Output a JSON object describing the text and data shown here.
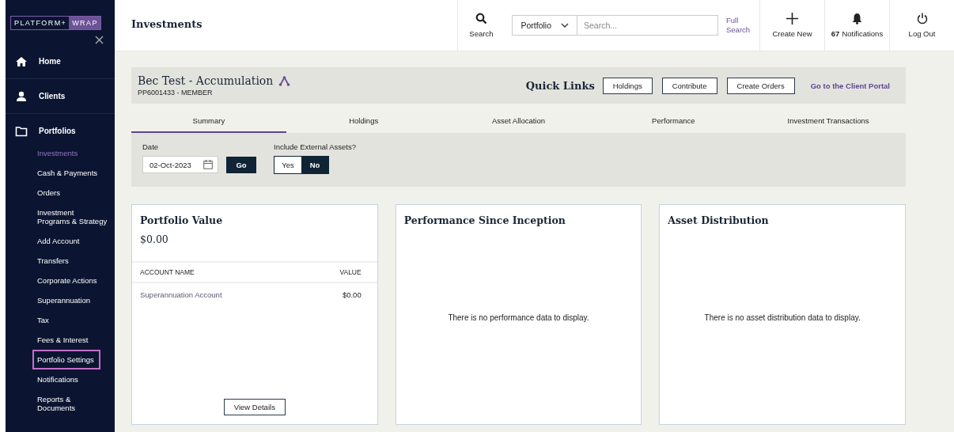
{
  "brand": {
    "part_1": "PLATFORM+",
    "part_2": "WRAP"
  },
  "sidebar": {
    "items": [
      {
        "label": "Home",
        "selected": false
      },
      {
        "label": "Clients",
        "selected": false
      },
      {
        "label": "Portfolios",
        "selected": false,
        "children": [
          {
            "label": "Investments",
            "selected": true,
            "highlighted": false
          },
          {
            "label": "Cash & Payments",
            "selected": false,
            "highlighted": false
          },
          {
            "label": "Orders",
            "selected": false,
            "highlighted": false
          },
          {
            "label": "Investment Programs & Strategy",
            "selected": false,
            "highlighted": false
          },
          {
            "label": "Add Account",
            "selected": false,
            "highlighted": false
          },
          {
            "label": "Transfers",
            "selected": false,
            "highlighted": false
          },
          {
            "label": "Corporate Actions",
            "selected": false,
            "highlighted": false
          },
          {
            "label": "Superannuation",
            "selected": false,
            "highlighted": false
          },
          {
            "label": "Tax",
            "selected": false,
            "highlighted": false
          },
          {
            "label": "Fees & Interest",
            "selected": false,
            "highlighted": false
          },
          {
            "label": "Portfolio Settings",
            "selected": false,
            "highlighted": true
          },
          {
            "label": "Notifications",
            "selected": false,
            "highlighted": false
          },
          {
            "label": "Reports & Documents",
            "selected": false,
            "highlighted": false
          }
        ]
      }
    ]
  },
  "header": {
    "title": "Investments",
    "search_label": "Search",
    "scope": "Portfolio",
    "placeholder": "Search...",
    "full_search": "Full Search",
    "actions": [
      {
        "kind": "create",
        "label": "Create New"
      },
      {
        "kind": "notifications",
        "count": "67",
        "label": "Notifications"
      },
      {
        "kind": "logout",
        "label": "Log Out"
      }
    ]
  },
  "client": {
    "name": "Bec Test - Accumulation",
    "code": "PP6001433 - MEMBER",
    "quick_links_title": "Quick Links",
    "quick_links": [
      "Holdings",
      "Contribute",
      "Create Orders"
    ],
    "portal_link": "Go to the Client Portal"
  },
  "tabs": [
    {
      "label": "Summary",
      "selected": true
    },
    {
      "label": "Holdings",
      "selected": false
    },
    {
      "label": "Asset Allocation",
      "selected": false
    },
    {
      "label": "Performance",
      "selected": false
    },
    {
      "label": "Investment Transactions",
      "selected": false
    }
  ],
  "filters": {
    "date_label": "Date",
    "date": "02-Oct-2023",
    "go": "Go",
    "external_label": "Include External Assets?",
    "options": [
      {
        "label": "Yes",
        "selected": false
      },
      {
        "label": "No",
        "selected": true
      }
    ]
  },
  "cards": [
    {
      "kind": "table",
      "title": "Portfolio Value",
      "total": "$0.00",
      "columns": [
        "ACCOUNT NAME",
        "VALUE"
      ],
      "rows": [
        {
          "name": "Superannuation Account",
          "value": "$0.00"
        }
      ],
      "button": "View Details"
    },
    {
      "kind": "empty",
      "title": "Performance Since Inception",
      "message": "There is no performance data to display."
    },
    {
      "kind": "empty",
      "title": "Asset Distribution",
      "message": "There is no asset distribution data to display."
    }
  ]
}
